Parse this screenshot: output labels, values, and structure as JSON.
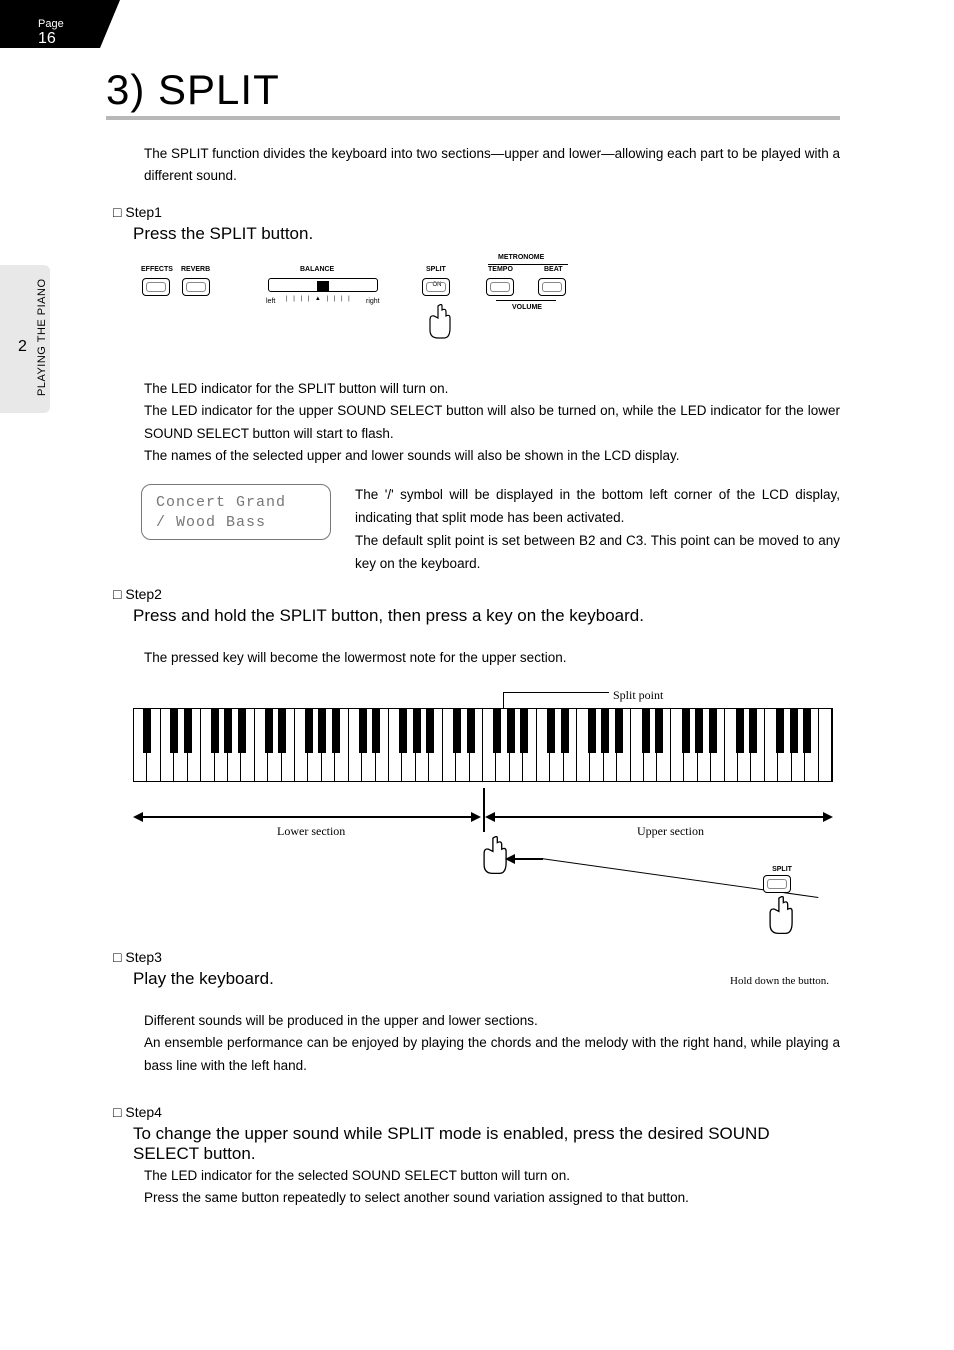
{
  "page": {
    "label": "Page",
    "number": "16",
    "section_number": "2",
    "section_label": "PLAYING THE PIANO"
  },
  "title": "3) SPLIT",
  "intro": "The SPLIT function divides the keyboard into two sections—upper and lower—allowing each part to be played with a different sound.",
  "step1": {
    "head": "Step1",
    "sub": "Press the SPLIT button.",
    "panel": {
      "effects": "EFFECTS",
      "reverb": "REVERB",
      "balance": "BALANCE",
      "left": "left",
      "right": "right",
      "split": "SPLIT",
      "on": "ON",
      "metronome": "METRONOME",
      "tempo": "TEMPO",
      "beat": "BEAT",
      "volume": "VOLUME"
    },
    "after_a": "The LED indicator for the SPLIT button will turn on.",
    "after_b": "The LED indicator for the upper SOUND SELECT button will also be turned on, while the LED indicator for the lower SOUND SELECT button will start to flash.",
    "after_c": "The names of the selected upper and lower sounds will also be shown in the LCD display.",
    "lcd_line1": "Concert Grand",
    "lcd_line2": "/  Wood Bass",
    "side_a": "The '/' symbol will be displayed in the bottom left corner of the LCD display, indicating that split mode has been activated.",
    "side_b": "The default split point is set between B2 and C3. This point can be moved to any key on the keyboard."
  },
  "step2": {
    "head": "Step2",
    "sub": "Press and hold the SPLIT button, then press a key on the keyboard.",
    "after": "The pressed key will become the lowermost note for the upper section.",
    "kb": {
      "split_point": "Split point",
      "lower": "Lower section",
      "upper": "Upper section",
      "split_btn": "SPLIT",
      "hold": "Hold down the button."
    }
  },
  "step3": {
    "head": "Step3",
    "sub": "Play the keyboard.",
    "after_a": "Different sounds will be produced in the upper and lower sections.",
    "after_b": "An ensemble performance can be enjoyed by playing the chords and the melody with the right hand, while playing a bass line with the left hand."
  },
  "step4": {
    "head": "Step4",
    "sub": "To change the upper sound while SPLIT mode is enabled, press the desired SOUND SELECT button.",
    "after_a": "The LED indicator for the selected SOUND SELECT button will turn on.",
    "after_b": "Press the same button repeatedly to select another sound variation assigned to that button."
  }
}
